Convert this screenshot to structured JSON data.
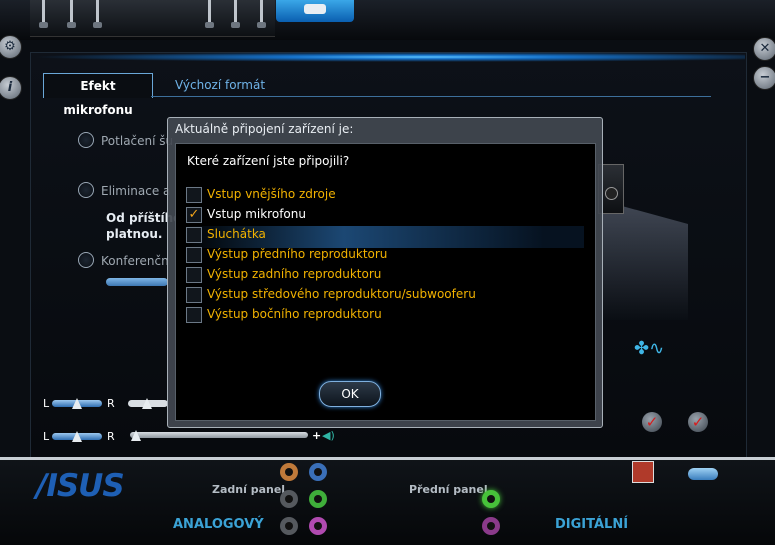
{
  "window": {
    "side_buttons": [
      "gear-icon",
      "info-icon",
      "close-icon",
      "minimize-icon"
    ]
  },
  "tabs": {
    "active": "Efekt mikrofonu",
    "inactive": "Výchozí formát"
  },
  "background": {
    "option1": "Potlačení šu",
    "option2": "Eliminace a",
    "note_line1": "Od příštího",
    "note_line2": "platnou.",
    "option3": "Konferenčn"
  },
  "volume": {
    "row1": {
      "left": "L",
      "right": "R"
    },
    "row2": {
      "left": "L",
      "right": "R",
      "plus": "+"
    }
  },
  "bottom": {
    "brand": "/ISUS",
    "rear_panel": "Zadní panel",
    "front_panel": "Přední panel",
    "analog": "ANALOGOVÝ",
    "digital": "DIGITÁLNÍ",
    "jack_colors": {
      "orange": "#c07a3a",
      "blue": "#3a6fb8",
      "gray": "#55595e",
      "green": "#3fae3a",
      "pink": "#b04ab0",
      "front_green": "#47c23a",
      "front_pink": "#8a3a8a"
    }
  },
  "dialog": {
    "title": "Aktuálně připojení zařízení je:",
    "question": "Které zařízení jste připojili?",
    "options": [
      {
        "label": "Vstup vnějšího zdroje",
        "checked": false
      },
      {
        "label": "Vstup mikrofonu",
        "checked": true
      },
      {
        "label": "Sluchátka",
        "checked": false
      },
      {
        "label": "Výstup předního reproduktoru",
        "checked": false
      },
      {
        "label": "Výstup zadního reproduktoru",
        "checked": false
      },
      {
        "label": "Výstup středového reproduktoru/subwooferu",
        "checked": false
      },
      {
        "label": "Výstup bočního reproduktoru",
        "checked": false
      }
    ],
    "ok_label": "OK",
    "check_mark": "✓"
  },
  "colors": {
    "accent": "#3ba3d6",
    "option_text": "#f2b200",
    "check": "#f2a41a"
  }
}
